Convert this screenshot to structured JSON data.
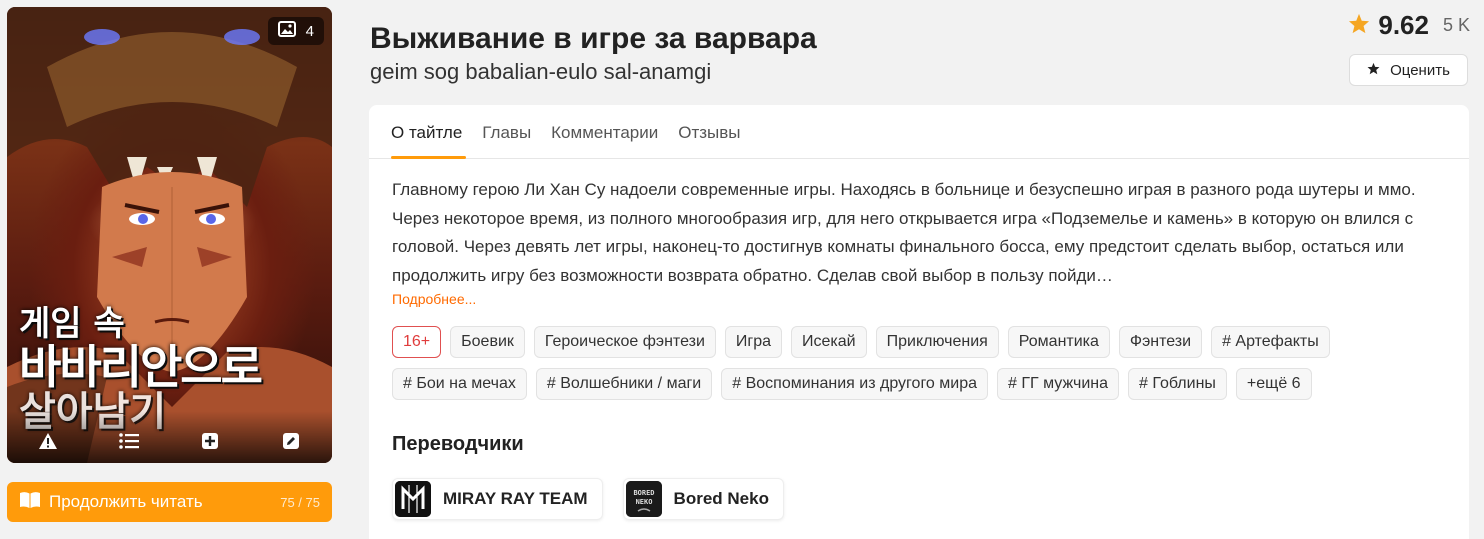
{
  "cover": {
    "image_count": "4",
    "logo_lines": [
      "게임 속",
      "바바리안으로",
      "살아남기"
    ]
  },
  "continue": {
    "label": "Продолжить читать",
    "progress": "75 / 75"
  },
  "header": {
    "title": "Выживание в игре за варвара",
    "subtitle": "geim sog babalian-eulo sal-anamgi"
  },
  "rating": {
    "score": "9.62",
    "votes": "5 K",
    "rate_label": "Оценить"
  },
  "tabs": [
    {
      "label": "О тайтле"
    },
    {
      "label": "Главы"
    },
    {
      "label": "Комментарии"
    },
    {
      "label": "Отзывы"
    }
  ],
  "description": "Главному герою Ли Хан Су надоели современные игры. Находясь в больнице и безуспешно играя в разного рода шутеры и ммо. Через некоторое время, из полного многообразия игр, для него открывается игра «Подземелье и камень» в которую он влился с головой. Через девять лет игры, наконец-то достигнув комнаты финального босса, ему предстоит сделать выбор, остаться или продолжить игру без возможности возврата обратно. Сделав свой выбор в пользу пойди…",
  "more_label": "Подробнее...",
  "tags": [
    "16+",
    "Боевик",
    "Героическое фэнтези",
    "Игра",
    "Исекай",
    "Приключения",
    "Романтика",
    "Фэнтези",
    "# Артефакты",
    "# Бои на мечах",
    "# Волшебники / маги",
    "# Воспоминания из другого мира",
    "# ГГ мужчина",
    "# Гоблины",
    "+ещё 6"
  ],
  "translators_title": "Переводчики",
  "translators": [
    {
      "name": "MIRAY RAY TEAM",
      "avatar_text": "M"
    },
    {
      "name": "Bored Neko",
      "avatar_text": "BORED NEKO"
    }
  ],
  "colors": {
    "accent": "#ff9b0b",
    "star": "#f5a623",
    "age_tag": "#e03c3c"
  }
}
